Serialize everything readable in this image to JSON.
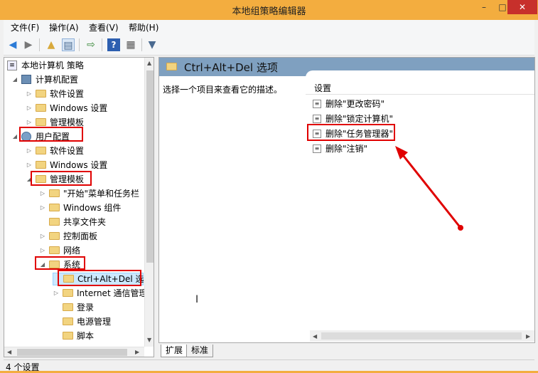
{
  "window": {
    "title": "本地组策略编辑器",
    "minimize": "–",
    "maximize": "□",
    "close": "✕"
  },
  "menu": [
    {
      "label": "文件(F)"
    },
    {
      "label": "操作(A)"
    },
    {
      "label": "查看(V)"
    },
    {
      "label": "帮助(H)"
    }
  ],
  "toolbar": [
    "back-arrow-icon",
    "forward-arrow-icon",
    "up-folder-icon",
    "show-tree-icon",
    "export-list-icon",
    "help-icon",
    "properties-icon",
    "filter-icon"
  ],
  "tree": {
    "root": "本地计算机 策略",
    "computer_config": "计算机配置",
    "cc_software": "软件设置",
    "cc_windows": "Windows 设置",
    "cc_admin": "管理模板",
    "user_config": "用户配置",
    "uc_software": "软件设置",
    "uc_windows": "Windows 设置",
    "uc_admin": "管理模板",
    "start_menu": "\"开始\"菜单和任务栏",
    "win_components": "Windows 组件",
    "shared_folders": "共享文件夹",
    "control_panel": "控制面板",
    "network": "网络",
    "system": "系统",
    "cad_options": "Ctrl+Alt+Del 选项",
    "internet_comm": "Internet 通信管理",
    "logon": "登录",
    "power": "电源管理",
    "scripts": "脚本"
  },
  "right": {
    "header": "Ctrl+Alt+Del 选项",
    "description": "选择一个项目来查看它的描述。",
    "column_header": "设置",
    "settings": [
      "删除\"更改密码\"",
      "删除\"锁定计算机\"",
      "删除\"任务管理器\"",
      "删除\"注销\""
    ]
  },
  "tabs": {
    "extended": "扩展",
    "standard": "标准"
  },
  "status": "4 个设置",
  "colors": {
    "title_bar": "#f3ad3f",
    "close_button": "#c7302b",
    "pane_header": "#7fa0c0",
    "highlight": "#e00000"
  }
}
